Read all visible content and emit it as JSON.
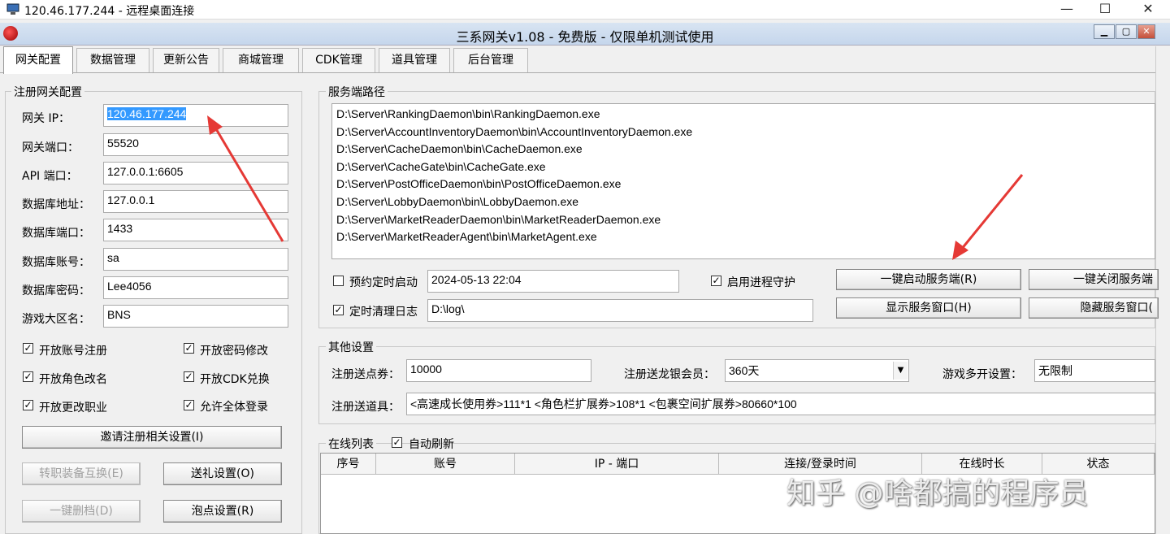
{
  "rdp": {
    "title": "120.46.177.244 - 远程桌面连接",
    "minimize": "—",
    "maximize": "☐",
    "close": "✕"
  },
  "app": {
    "title": "三系网关v1.08 - 免费版 - 仅限单机测试使用"
  },
  "tabs": [
    "网关配置",
    "数据管理",
    "更新公告",
    "商城管理",
    "CDK管理",
    "道具管理",
    "后台管理"
  ],
  "register": {
    "group_label": "注册网关配置",
    "fields": [
      {
        "label": "网关 IP：",
        "value": "120.46.177.244"
      },
      {
        "label": "网关端口：",
        "value": "55520"
      },
      {
        "label": "API 端口：",
        "value": "127.0.0.1:6605"
      },
      {
        "label": "数据库地址：",
        "value": "127.0.0.1"
      },
      {
        "label": "数据库端口：",
        "value": "1433"
      },
      {
        "label": "数据库账号：",
        "value": "sa"
      },
      {
        "label": "数据库密码：",
        "value": "Lee4056"
      },
      {
        "label": "游戏大区名：",
        "value": "BNS"
      }
    ],
    "checks": [
      {
        "label": "开放账号注册",
        "checked": true
      },
      {
        "label": "开放密码修改",
        "checked": true
      },
      {
        "label": "开放角色改名",
        "checked": true
      },
      {
        "label": "开放CDK兑换",
        "checked": true
      },
      {
        "label": "开放更改职业",
        "checked": true
      },
      {
        "label": "允许全体登录",
        "checked": true
      }
    ],
    "invite_button": "邀请注册相关设置(I)",
    "transfer_button": "转职装备互换(E)",
    "gift_button": "送礼设置(O)",
    "delete_button": "一键删档(D)",
    "bubble_button": "泡点设置(R)"
  },
  "server": {
    "group_label": "服务端路径",
    "paths": [
      "D:\\Server\\RankingDaemon\\bin\\RankingDaemon.exe",
      "D:\\Server\\AccountInventoryDaemon\\bin\\AccountInventoryDaemon.exe",
      "D:\\Server\\CacheDaemon\\bin\\CacheDaemon.exe",
      "D:\\Server\\CacheGate\\bin\\CacheGate.exe",
      "D:\\Server\\PostOfficeDaemon\\bin\\PostOfficeDaemon.exe",
      "D:\\Server\\LobbyDaemon\\bin\\LobbyDaemon.exe",
      "D:\\Server\\MarketReaderDaemon\\bin\\MarketReaderDaemon.exe",
      "D:\\Server\\MarketReaderAgent\\bin\\MarketAgent.exe"
    ],
    "schedule_label": "预约定时启动",
    "schedule_checked": false,
    "schedule_value": "2024-05-13 22:04",
    "guard_label": "启用进程守护",
    "guard_checked": true,
    "clean_label": "定时清理日志",
    "clean_checked": true,
    "clean_value": "D:\\log\\",
    "start_button": "一键启动服务端(R)",
    "stop_button": "一键关闭服务端",
    "show_button": "显示服务窗口(H)",
    "hide_button": "隐藏服务窗口("
  },
  "other": {
    "group_label": "其他设置",
    "points_label": "注册送点券：",
    "points_value": "10000",
    "vip_label": "注册送龙银会员：",
    "vip_value": "360天",
    "multi_label": "游戏多开设置：",
    "multi_value": "无限制",
    "items_label": "注册送道具：",
    "items_value": "<高速成长使用券>111*1 <角色栏扩展券>108*1 <包裹空间扩展券>80660*100"
  },
  "online": {
    "group_label": "在线列表",
    "auto_label": "自动刷新",
    "auto_checked": true,
    "columns": [
      "序号",
      "账号",
      "IP - 端口",
      "连接/登录时间",
      "在线时长",
      "状态"
    ]
  },
  "watermark": "知乎 @啥都搞的程序员",
  "colors": {
    "selection": "#3399ff",
    "arrow": "#e53935",
    "title_bar": "#c5d6ec"
  },
  "check_mark": "✓"
}
